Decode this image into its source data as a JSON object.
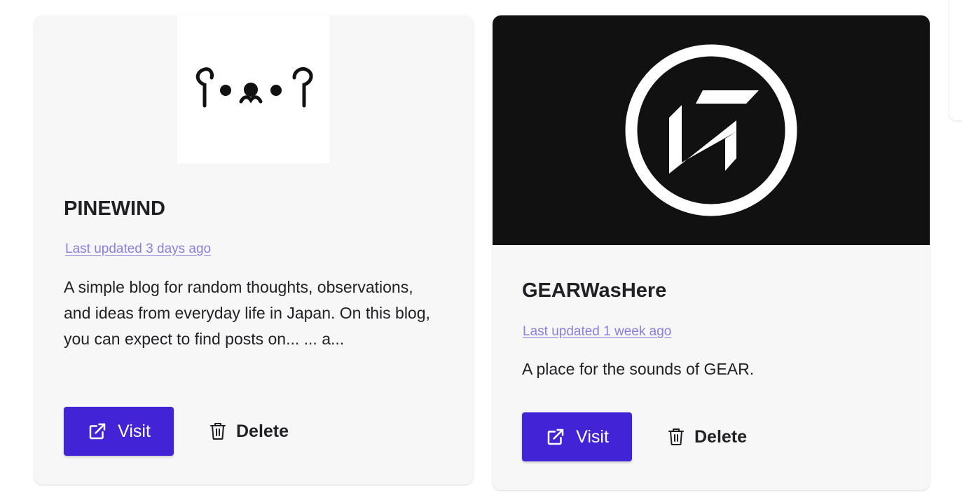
{
  "blogs": [
    {
      "title": "PINEWIND",
      "updated": "Last updated 3 days ago",
      "description": "A simple blog for random thoughts, observations, and ideas from everyday life in Japan. On this blog, you can expect to find posts on... ... a...",
      "thumbnail_text": "ʕ•ᴥ•ʔ",
      "visit_label": "Visit",
      "delete_label": "Delete"
    },
    {
      "title": "GEARWasHere",
      "updated": "Last updated 1 week ago",
      "description": "A place for the sounds of GEAR.",
      "visit_label": "Visit",
      "delete_label": "Delete"
    }
  ],
  "icons": {
    "visit": "external-link-icon",
    "delete": "trash-icon",
    "logo": "gear-logo-icon"
  },
  "colors": {
    "accent": "#4224d6",
    "link": "#8a7ee0",
    "card_bg": "#f7f7f8",
    "dark_thumb": "#111111"
  }
}
